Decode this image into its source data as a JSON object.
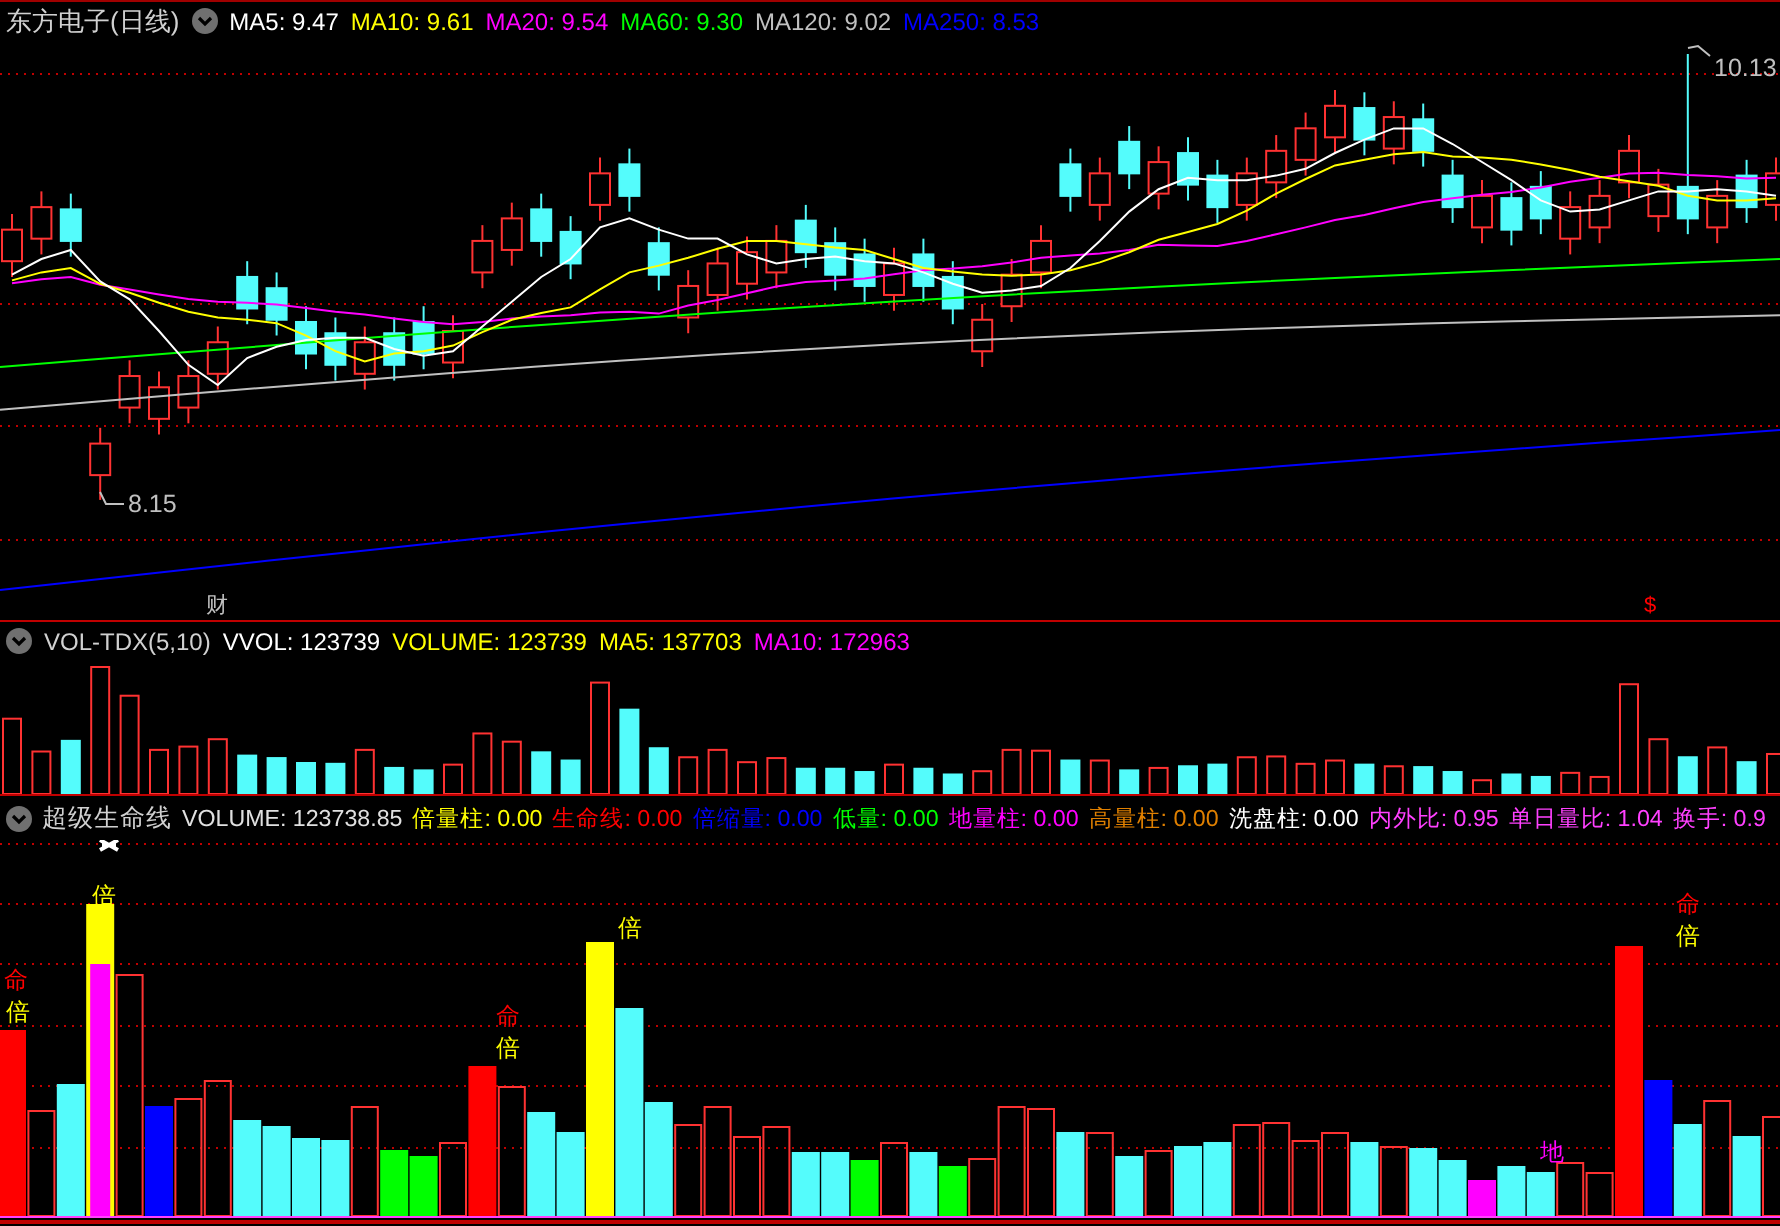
{
  "title": {
    "text": "东方电子(日线)"
  },
  "main_legend": [
    {
      "text": "MA5: 9.47",
      "color": "#ffffff"
    },
    {
      "text": "MA10: 9.61",
      "color": "#ffff00"
    },
    {
      "text": "MA20: 9.54",
      "color": "#ff00ff"
    },
    {
      "text": "MA60: 9.30",
      "color": "#00ff00"
    },
    {
      "text": "MA120: 9.02",
      "color": "#c0c0c0"
    },
    {
      "text": "MA250: 8.53",
      "color": "#0000ff"
    }
  ],
  "main_chart": {
    "labels": [
      {
        "kind": "high",
        "text": "10.13",
        "color": "#c0c0c0"
      },
      {
        "kind": "low",
        "text": "8.15",
        "color": "#c0c0c0"
      },
      {
        "kind": "event",
        "text": "财",
        "color": "#c0c0c0"
      },
      {
        "kind": "event",
        "text": "$",
        "color": "#ff0000"
      }
    ]
  },
  "volume": {
    "name": "VOL-TDX(5,10)",
    "legend": [
      {
        "text": "VVOL: 123739",
        "color": "#ffffff"
      },
      {
        "text": "VOLUME: 123739",
        "color": "#ffff00"
      },
      {
        "text": "MA5: 137703",
        "color": "#ffff00"
      },
      {
        "text": "MA10: 172963",
        "color": "#ff00ff"
      }
    ]
  },
  "indicator": {
    "name": "超级生命线",
    "legend": [
      {
        "text": "VOLUME: 123738.85",
        "color": "#e0e0e0"
      },
      {
        "text": "倍量柱: 0.00",
        "color": "#ffff00"
      },
      {
        "text": "生命线: 0.00",
        "color": "#ff0000"
      },
      {
        "text": "倍缩量: 0.00",
        "color": "#0000ff"
      },
      {
        "text": "低量: 0.00",
        "color": "#00ff00"
      },
      {
        "text": "地量柱: 0.00",
        "color": "#ff00ff"
      },
      {
        "text": "高量柱: 0.00",
        "color": "#e08000"
      },
      {
        "text": "洗盘柱: 0.00",
        "color": "#ffffff"
      },
      {
        "text": "内外比: 0.95",
        "color": "#ff40ff"
      },
      {
        "text": "单日量比: 1.04",
        "color": "#ff40ff"
      },
      {
        "text": "换手: 0.9",
        "color": "#ff40ff"
      }
    ],
    "markers": [
      {
        "text": "命",
        "color": "#ff0000"
      },
      {
        "text": "倍",
        "color": "#ffff00"
      },
      {
        "text": "倍",
        "color": "#ffff00"
      },
      {
        "text": "命",
        "color": "#ff0000"
      },
      {
        "text": "倍",
        "color": "#ffff00"
      },
      {
        "text": "倍",
        "color": "#ffff00"
      },
      {
        "text": "地",
        "color": "#ff00ff"
      },
      {
        "text": "命",
        "color": "#ff0000"
      },
      {
        "text": "倍",
        "color": "#ffff00"
      }
    ]
  }
}
